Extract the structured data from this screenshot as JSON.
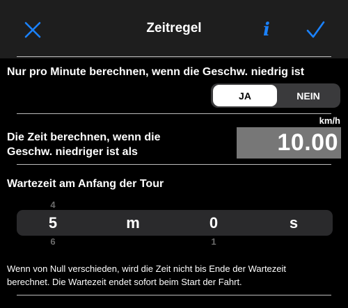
{
  "nav": {
    "title": "Zeitregel",
    "info_label": "i",
    "close_icon": "close-icon",
    "check_icon": "checkmark-icon",
    "accent_color": "#1a82ff"
  },
  "per_minute": {
    "label": "Nur pro Minute berechnen, wenn die Geschw. niedrig ist",
    "options": [
      "JA",
      "NEIN"
    ],
    "selected": "JA"
  },
  "threshold": {
    "label_line1": "Die Zeit berechnen, wenn die",
    "label_line2": "Geschw. niedriger ist als",
    "unit": "km/h",
    "value": "10.00"
  },
  "waiting": {
    "label": "Wartezeit am Anfang der Tour",
    "picker": {
      "minutes": "5",
      "minutes_above": "4",
      "minutes_below": "6",
      "minutes_unit": "m",
      "seconds": "0",
      "seconds_below": "1",
      "seconds_unit": "s"
    }
  },
  "note": {
    "line1": "Wenn von Null verschieden, wird die Zeit nicht bis Ende der Wartezeit",
    "line2": "berechnet. Die Wartezeit endet sofort beim Start der Fahrt."
  }
}
